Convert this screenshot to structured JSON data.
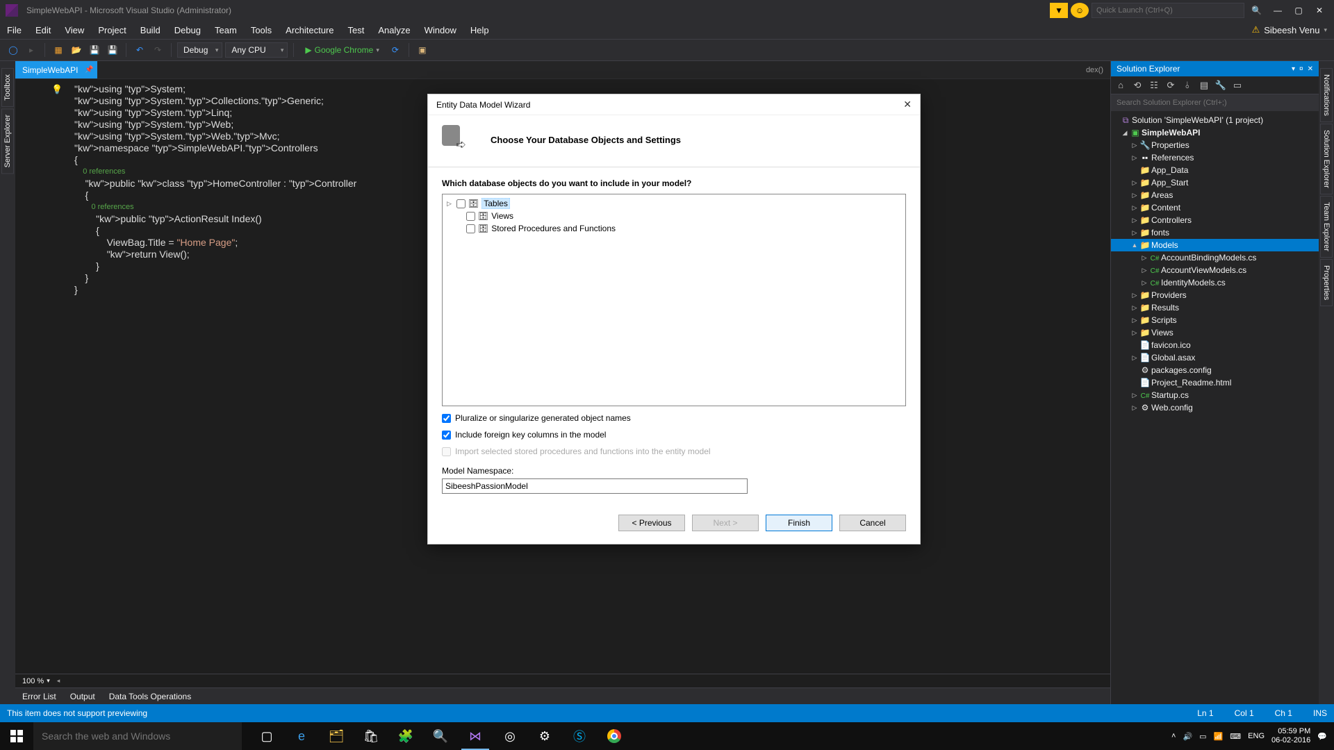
{
  "titlebar": {
    "title": "SimpleWebAPI - Microsoft Visual Studio (Administrator)",
    "quick_launch_placeholder": "Quick Launch (Ctrl+Q)"
  },
  "menubar": {
    "items": [
      "File",
      "Edit",
      "View",
      "Project",
      "Build",
      "Debug",
      "Team",
      "Tools",
      "Architecture",
      "Test",
      "Analyze",
      "Window",
      "Help"
    ],
    "user": "Sibeesh Venu"
  },
  "toolbar": {
    "config": "Debug",
    "platform": "Any CPU",
    "run_target": "Google Chrome"
  },
  "editor": {
    "tab_name": "SimpleWebAPI",
    "breadcrumb_right": "dex()",
    "zoom": "100 %",
    "code_lines": [
      {
        "t": "using System;",
        "cls": "u"
      },
      {
        "t": "using System.Collections.Generic;",
        "cls": "u"
      },
      {
        "t": "using System.Linq;",
        "cls": "u"
      },
      {
        "t": "using System.Web;",
        "cls": "u"
      },
      {
        "t": "using System.Web.Mvc;",
        "cls": "u"
      },
      {
        "t": "",
        "cls": ""
      },
      {
        "t": "namespace SimpleWebAPI.Controllers",
        "cls": "ns"
      },
      {
        "t": "{",
        "cls": ""
      },
      {
        "t": "    0 references",
        "cls": "ref"
      },
      {
        "t": "    public class HomeController : Controller",
        "cls": "cl"
      },
      {
        "t": "    {",
        "cls": ""
      },
      {
        "t": "        0 references",
        "cls": "ref"
      },
      {
        "t": "        public ActionResult Index()",
        "cls": "m"
      },
      {
        "t": "        {",
        "cls": ""
      },
      {
        "t": "            ViewBag.Title = \"Home Page\";",
        "cls": "body"
      },
      {
        "t": "",
        "cls": ""
      },
      {
        "t": "            return View();",
        "cls": "ret"
      },
      {
        "t": "        }",
        "cls": ""
      },
      {
        "t": "    }",
        "cls": ""
      },
      {
        "t": "}",
        "cls": ""
      }
    ]
  },
  "left_panels": [
    "Toolbox",
    "Server Explorer"
  ],
  "right_panels": [
    "Notifications",
    "Solution Explorer",
    "Team Explorer",
    "Properties"
  ],
  "solution_explorer": {
    "title": "Solution Explorer",
    "search_placeholder": "Search Solution Explorer (Ctrl+;)",
    "root": "Solution 'SimpleWebAPI' (1 project)",
    "project": "SimpleWebAPI",
    "items": [
      {
        "icon": "wrench",
        "label": "Properties",
        "exp": "▷",
        "ind": 2
      },
      {
        "icon": "ref",
        "label": "References",
        "exp": "▷",
        "ind": 2
      },
      {
        "icon": "folder",
        "label": "App_Data",
        "exp": "",
        "ind": 2
      },
      {
        "icon": "folder",
        "label": "App_Start",
        "exp": "▷",
        "ind": 2
      },
      {
        "icon": "folder",
        "label": "Areas",
        "exp": "▷",
        "ind": 2
      },
      {
        "icon": "folder",
        "label": "Content",
        "exp": "▷",
        "ind": 2
      },
      {
        "icon": "folder",
        "label": "Controllers",
        "exp": "▷",
        "ind": 2
      },
      {
        "icon": "folder",
        "label": "fonts",
        "exp": "▷",
        "ind": 2
      },
      {
        "icon": "folder",
        "label": "Models",
        "exp": "▲",
        "ind": 2,
        "sel": true
      },
      {
        "icon": "cs",
        "label": "AccountBindingModels.cs",
        "exp": "▷",
        "ind": 3
      },
      {
        "icon": "cs",
        "label": "AccountViewModels.cs",
        "exp": "▷",
        "ind": 3
      },
      {
        "icon": "cs",
        "label": "IdentityModels.cs",
        "exp": "▷",
        "ind": 3
      },
      {
        "icon": "folder",
        "label": "Providers",
        "exp": "▷",
        "ind": 2
      },
      {
        "icon": "folder",
        "label": "Results",
        "exp": "▷",
        "ind": 2
      },
      {
        "icon": "folder",
        "label": "Scripts",
        "exp": "▷",
        "ind": 2
      },
      {
        "icon": "folder",
        "label": "Views",
        "exp": "▷",
        "ind": 2
      },
      {
        "icon": "file",
        "label": "favicon.ico",
        "exp": "",
        "ind": 2
      },
      {
        "icon": "file",
        "label": "Global.asax",
        "exp": "▷",
        "ind": 2
      },
      {
        "icon": "conf",
        "label": "packages.config",
        "exp": "",
        "ind": 2
      },
      {
        "icon": "file",
        "label": "Project_Readme.html",
        "exp": "",
        "ind": 2
      },
      {
        "icon": "cs",
        "label": "Startup.cs",
        "exp": "▷",
        "ind": 2
      },
      {
        "icon": "conf",
        "label": "Web.config",
        "exp": "▷",
        "ind": 2
      }
    ]
  },
  "bottom_tabs": [
    "Error List",
    "Output",
    "Data Tools Operations"
  ],
  "status": {
    "msg": "This item does not support previewing",
    "ln": "Ln 1",
    "col": "Col 1",
    "ch": "Ch 1",
    "ins": "INS"
  },
  "dialog": {
    "title": "Entity Data Model Wizard",
    "heading": "Choose Your Database Objects and Settings",
    "question": "Which database objects do you want to include in your model?",
    "nodes": [
      {
        "label": "Tables",
        "sel": true,
        "exp": true
      },
      {
        "label": "Views",
        "sel": false,
        "exp": false
      },
      {
        "label": "Stored Procedures and Functions",
        "sel": false,
        "exp": false
      }
    ],
    "cb_pluralize": "Pluralize or singularize generated object names",
    "cb_fk": "Include foreign key columns in the model",
    "cb_import": "Import selected stored procedures and functions into the entity model",
    "ns_label": "Model Namespace:",
    "ns_value": "SibeeshPassionModel",
    "btn_prev": "< Previous",
    "btn_next": "Next >",
    "btn_finish": "Finish",
    "btn_cancel": "Cancel"
  },
  "taskbar": {
    "search_placeholder": "Search the web and Windows",
    "lang": "ENG",
    "time": "05:59 PM",
    "date": "06-02-2016"
  }
}
